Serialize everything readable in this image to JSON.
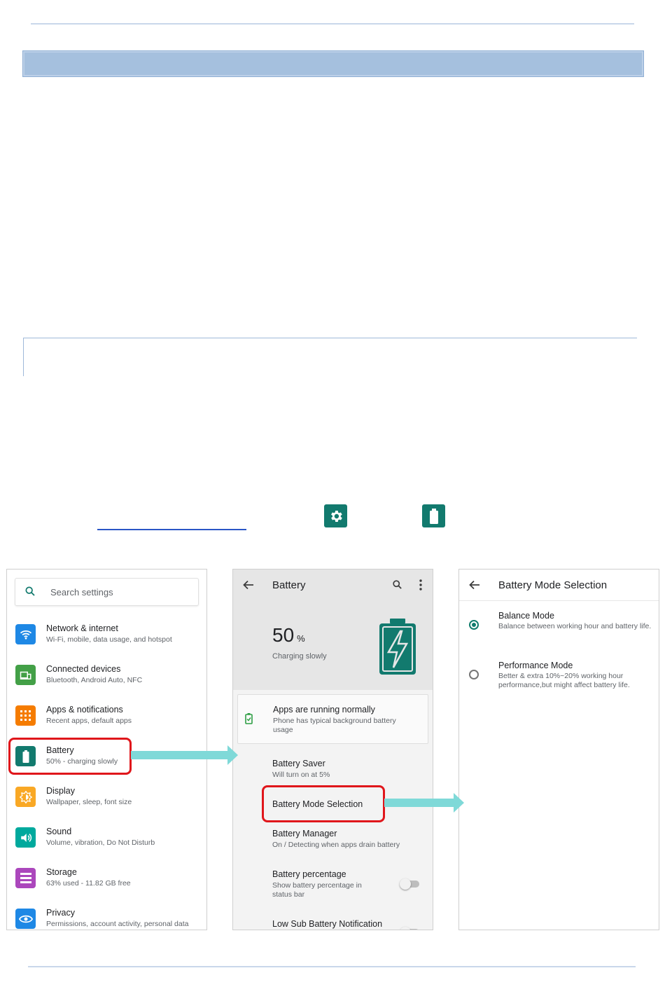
{
  "colors": {
    "accent": "#127a6e",
    "highlight": "#e0161b",
    "arrow": "#7fd9d8",
    "band": "#a5c0de"
  },
  "settings_list": {
    "search_placeholder": "Search settings",
    "items": [
      {
        "title": "Network & internet",
        "subtitle": "Wi-Fi, mobile, data usage, and hotspot",
        "icon": "wifi-icon",
        "color": "#1e88e5"
      },
      {
        "title": "Connected devices",
        "subtitle": "Bluetooth, Android Auto, NFC",
        "icon": "devices-icon",
        "color": "#43a047"
      },
      {
        "title": "Apps & notifications",
        "subtitle": "Recent apps, default apps",
        "icon": "apps-grid-icon",
        "color": "#f57c00"
      },
      {
        "title": "Battery",
        "subtitle": "50% - charging slowly",
        "icon": "battery-icon",
        "color": "#127a6e"
      },
      {
        "title": "Display",
        "subtitle": "Wallpaper, sleep, font size",
        "icon": "brightness-icon",
        "color": "#f9a825"
      },
      {
        "title": "Sound",
        "subtitle": "Volume, vibration, Do Not Disturb",
        "icon": "volume-icon",
        "color": "#00a99d"
      },
      {
        "title": "Storage",
        "subtitle": "63% used - 11.82 GB free",
        "icon": "storage-icon",
        "color": "#ab47bc"
      },
      {
        "title": "Privacy",
        "subtitle": "Permissions, account activity, personal data",
        "icon": "privacy-eye-icon",
        "color": "#1e88e5"
      }
    ]
  },
  "battery_screen": {
    "title": "Battery",
    "percent": "50",
    "percent_unit": "%",
    "status": "Charging slowly",
    "card": {
      "title": "Apps are running normally",
      "subtitle": "Phone has typical background battery usage"
    },
    "rows": [
      {
        "title": "Battery Saver",
        "subtitle": "Will turn on at 5%"
      },
      {
        "title": "Battery Mode Selection",
        "subtitle": ""
      },
      {
        "title": "Battery Manager",
        "subtitle": "On / Detecting when apps drain battery"
      },
      {
        "title": "Battery percentage",
        "subtitle": "Show battery percentage in status bar"
      },
      {
        "title": "Low Sub Battery Notification",
        "subtitle": ""
      }
    ]
  },
  "mode_screen": {
    "title": "Battery Mode Selection",
    "options": [
      {
        "title": "Balance Mode",
        "subtitle": "Balance between working hour and battery life.",
        "selected": true
      },
      {
        "title": "Performance Mode",
        "subtitle": "Better & extra 10%~20% working hour performance,but might affect battery life.",
        "selected": false
      }
    ]
  }
}
